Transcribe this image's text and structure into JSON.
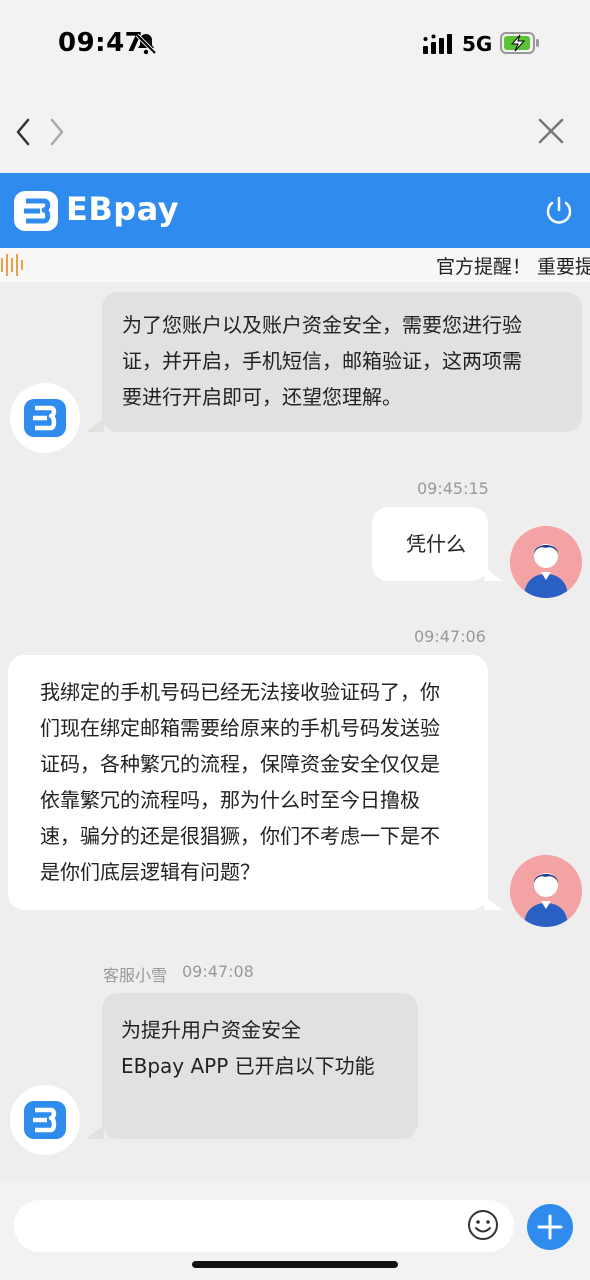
{
  "status_bar": {
    "time": "09:47",
    "network": "5G"
  },
  "header": {
    "brand": "EBpay"
  },
  "notice": {
    "text": "官方提醒！ 重要提"
  },
  "messages": [
    {
      "sender": "bot",
      "lines": [
        "为了您账户以及账户资金安全，需要您进行验",
        "证，并开启，手机短信，邮箱验证，这两项需",
        "要进行开启即可，还望您理解。"
      ]
    },
    {
      "sender": "user",
      "time": "09:45:15",
      "lines": [
        "凭什么"
      ]
    },
    {
      "sender": "user",
      "time": "09:47:06",
      "lines": [
        "我绑定的手机号码已经无法接收验证码了，你",
        "们现在绑定邮箱需要给原来的手机号码发送验",
        "证码，各种繁冗的流程，保障资金安全仅仅是",
        "依靠繁冗的流程吗，那为什么时至今日撸极",
        "速，骗分的还是很猖獗，你们不考虑一下是不",
        "是你们底层逻辑有问题？"
      ]
    },
    {
      "sender": "bot",
      "name": "客服小雪",
      "time": "09:47:08",
      "lines": [
        "为提升用户资金安全",
        "EBpay APP 已开启以下功能"
      ]
    }
  ],
  "icons": {
    "bell": "bell-slash-icon",
    "signal": "signal-bars-icon",
    "battery": "battery-charging-icon",
    "back": "chevron-left-icon",
    "forward": "chevron-right-icon",
    "close": "close-icon",
    "power": "power-icon",
    "notice": "sound-wave-icon",
    "emoji": "emoji-icon",
    "plus": "plus-icon"
  },
  "colors": {
    "brand": "#2f8bee",
    "battery_fill": "#5ac336",
    "user_avatar_bg": "#f3a3a3"
  }
}
